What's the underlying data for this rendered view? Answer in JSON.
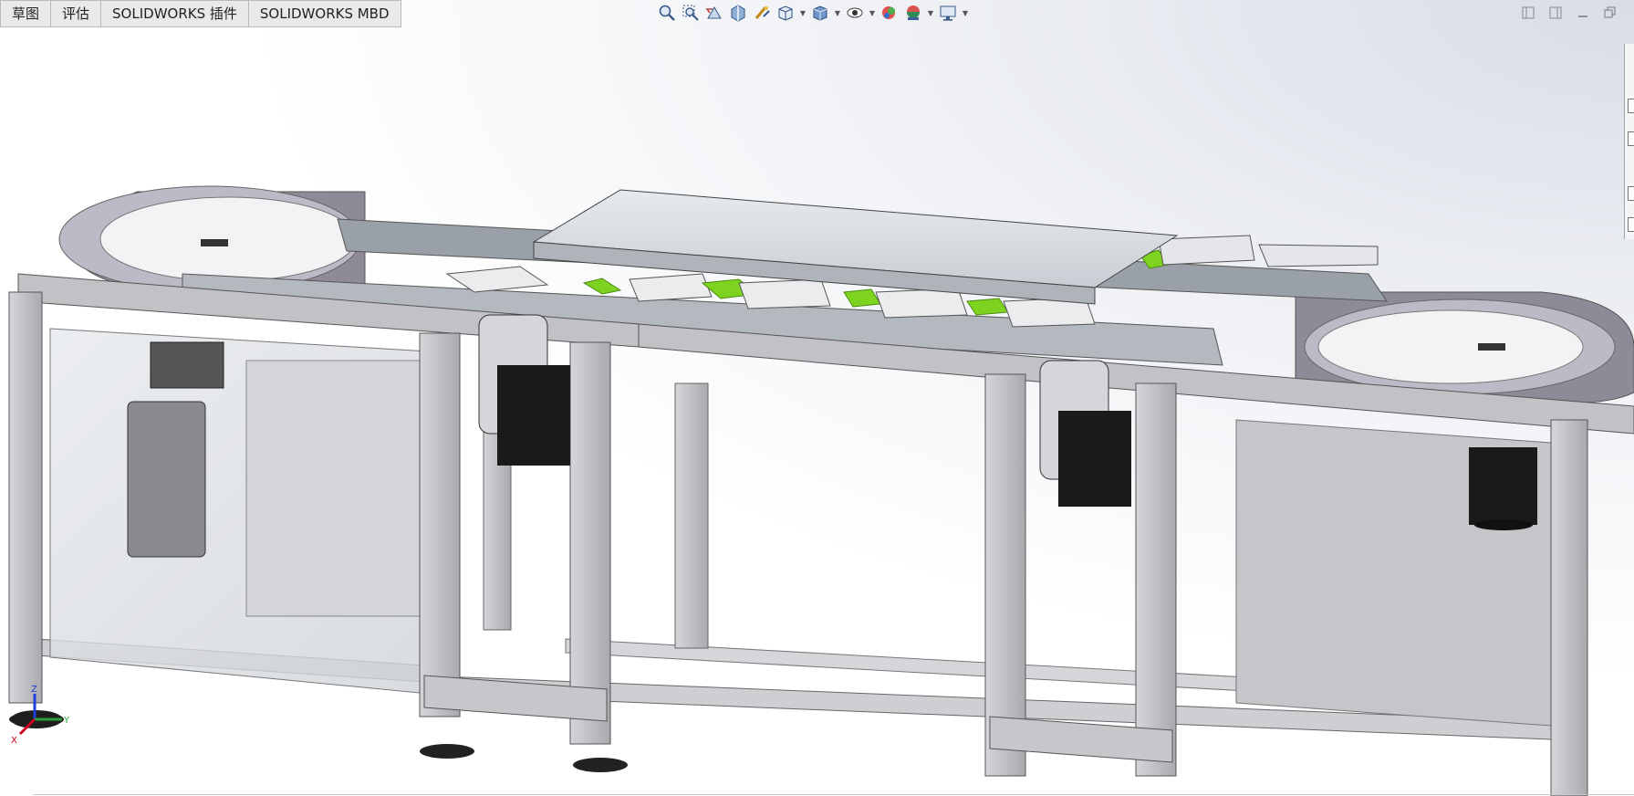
{
  "command_manager": {
    "tabs": [
      {
        "label": "草图"
      },
      {
        "label": "评估"
      },
      {
        "label": "SOLIDWORKS 插件"
      },
      {
        "label": "SOLIDWORKS MBD"
      }
    ]
  },
  "heads_up_toolbar": {
    "icons": [
      "zoom-to-fit-icon",
      "zoom-to-area-icon",
      "previous-view-icon",
      "section-view-icon",
      "dynamic-annotation-icon",
      "view-orientation-icon",
      "display-style-icon",
      "hide-show-items-icon",
      "edit-appearance-icon",
      "apply-scene-icon",
      "view-settings-icon"
    ]
  },
  "window_controls": {
    "icons": [
      "tile-left-icon",
      "tile-right-icon",
      "minimize-icon",
      "restore-icon"
    ]
  },
  "triad": {
    "x_label": "X",
    "y_label": "Y",
    "z_label": "Z"
  },
  "colors": {
    "frame": "#c9c9cc",
    "frame_dark": "#8d8d92",
    "highlight_green": "#7ed321",
    "motor_black": "#1a1a1a",
    "axis_x": "#d0021b",
    "axis_y": "#2a9d3a",
    "axis_z": "#1f3fd6"
  }
}
